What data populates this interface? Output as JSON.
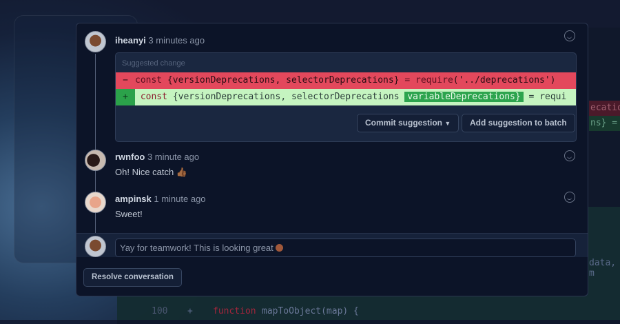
{
  "background_code": {
    "frag_red": "ecatio",
    "frag_green": "ns} =",
    "frag_data": "data, m",
    "line_number": "100",
    "line_sign": "+",
    "line_keyword": "function",
    "line_code": "mapToObject(map) {"
  },
  "comments": [
    {
      "author": "iheanyi",
      "time": "3 minutes ago"
    },
    {
      "author": "rwnfoo",
      "time": "3 minute ago",
      "body": "Oh! Nice catch 👍🏾"
    },
    {
      "author": "ampinsk",
      "time": "1 minute ago",
      "body": "Sweet!"
    }
  ],
  "suggestion": {
    "title": "Suggested change",
    "deleted": {
      "sign": "−",
      "kw": "const",
      "code": " {versionDeprecations, selectorDeprecations} ",
      "eq": "= require",
      "rest": "('../deprecations')"
    },
    "added": {
      "sign": "+",
      "kw": "const",
      "code": " {versionDeprecations, selectorDeprecations ",
      "highlight": "variableDeprecations}",
      "rest": " = requi"
    },
    "commit_label": "Commit suggestion",
    "batch_label": "Add suggestion to batch"
  },
  "reply": {
    "value": "Yay for teamwork! This is looking great"
  },
  "resolve_label": "Resolve conversation",
  "colors": {
    "deleted": "#e3485c",
    "added": "#c5f4c0",
    "added_highlight": "#2da44e"
  }
}
